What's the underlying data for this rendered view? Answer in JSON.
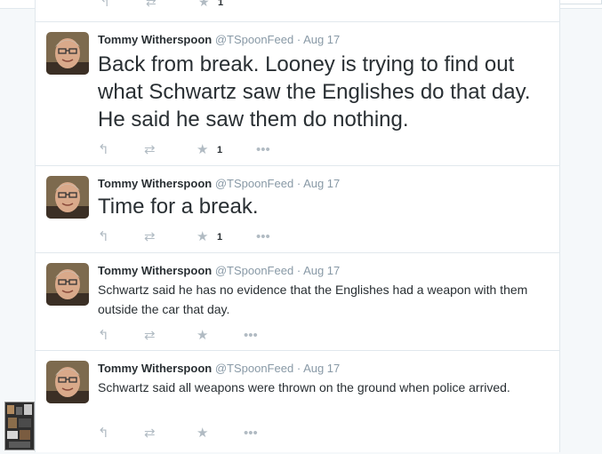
{
  "colors": {
    "name": "#292f33",
    "meta": "#8899a6",
    "action": "#b1bbc3",
    "border": "#e1e8ed"
  },
  "icons": {
    "reply": "reply-icon",
    "retweet": "retweet-icon",
    "favorite": "star-icon",
    "more": "more-icon"
  },
  "prev_actions": {
    "fav_count": "1"
  },
  "tweets": [
    {
      "fullname": "Tommy Witherspoon",
      "username": "@TSpoonFeed",
      "sep": "·",
      "time": "Aug 17",
      "text": "Back from break. Looney is trying to find out what Schwartz saw the Englishes do that day. He said he saw them do nothing.",
      "favorites": "1"
    },
    {
      "fullname": "Tommy Witherspoon",
      "username": "@TSpoonFeed",
      "sep": "·",
      "time": "Aug 17",
      "text": "Time for a break.",
      "favorites": "1"
    },
    {
      "fullname": "Tommy Witherspoon",
      "username": "@TSpoonFeed",
      "sep": "·",
      "time": "Aug 17",
      "text": "Schwartz said he has no evidence that the Englishes had a weapon with them outside the car that day.",
      "favorites": ""
    },
    {
      "fullname": "Tommy Witherspoon",
      "username": "@TSpoonFeed",
      "sep": "·",
      "time": "Aug 17",
      "text": "Schwartz said all weapons were thrown on the ground when police arrived.",
      "favorites": ""
    }
  ]
}
